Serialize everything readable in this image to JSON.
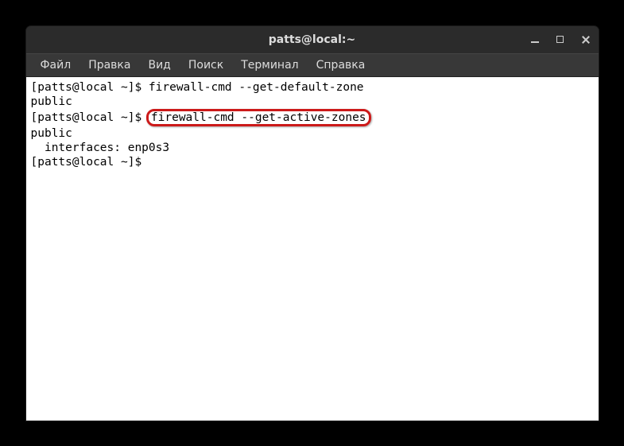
{
  "window": {
    "title": "patts@local:~"
  },
  "menu": {
    "file": "Файл",
    "edit": "Правка",
    "view": "Вид",
    "search": "Поиск",
    "terminal": "Терминал",
    "help": "Справка"
  },
  "terminal": {
    "prompt": "[patts@local ~]$ ",
    "cmd1": "firewall-cmd --get-default-zone",
    "out1": "public",
    "cmd2_highlighted": "firewall-cmd --get-active-zones",
    "out2_line1": "public",
    "out2_line2": "  interfaces: enp0s3",
    "final_prompt": "[patts@local ~]$ "
  }
}
